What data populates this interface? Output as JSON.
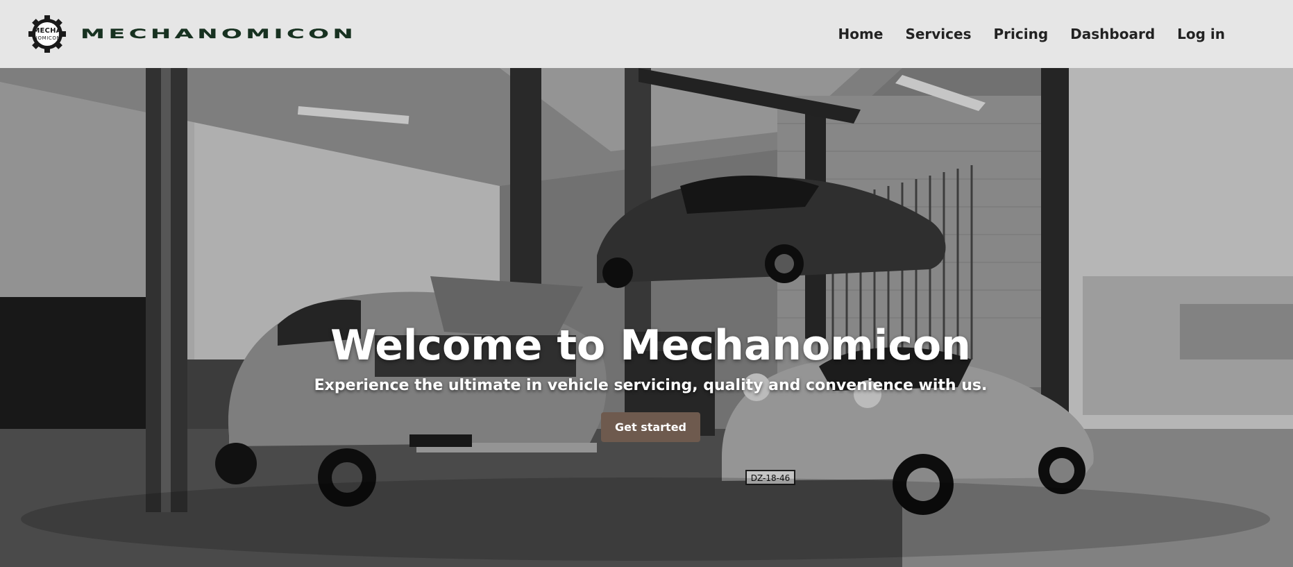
{
  "brand": {
    "badge_line1": "MECHA",
    "badge_line2": "NOMICON",
    "wordmark": "MECHANOMICON"
  },
  "nav": {
    "items": [
      {
        "label": "Home"
      },
      {
        "label": "Services"
      },
      {
        "label": "Pricing"
      },
      {
        "label": "Dashboard"
      },
      {
        "label": "Log in"
      }
    ]
  },
  "hero": {
    "title": "Welcome to Mechanomicon",
    "subtitle": "Experience the ultimate in vehicle servicing, quality and convenience with us.",
    "cta_label": "Get started",
    "background": "black-and-white photo of a garage workshop with classic sports cars, one raised on a lift",
    "plate_text": "DZ-18-46"
  },
  "colors": {
    "navbar_bg": "#e6e6e6",
    "wordmark": "#173120",
    "nav_text": "#222222",
    "cta_bg": "#6e5a4e",
    "hero_text": "#ffffff"
  }
}
